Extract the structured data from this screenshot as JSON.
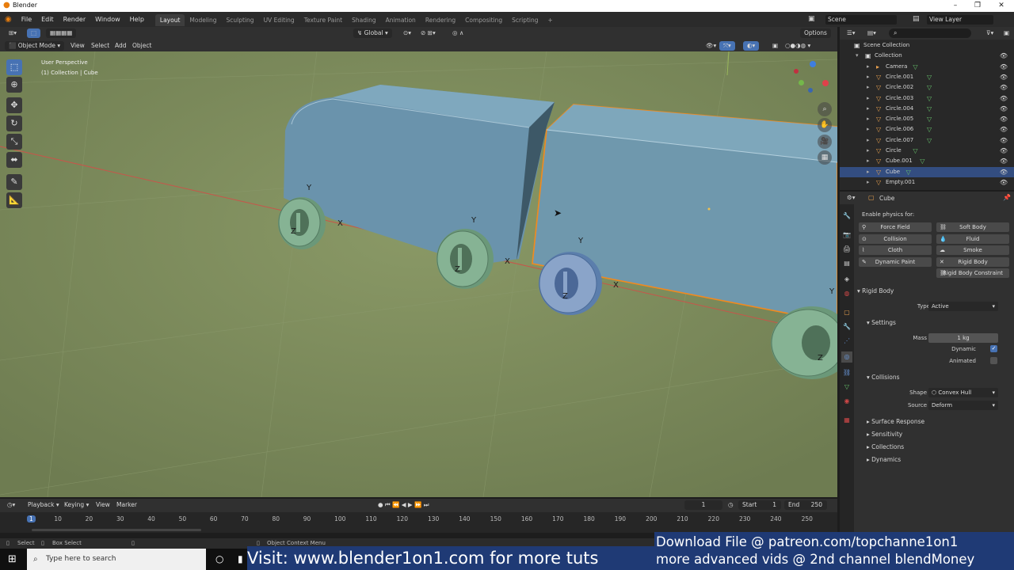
{
  "window": {
    "title": "Blender",
    "controls": [
      "–",
      "❐",
      "✕"
    ]
  },
  "menu": [
    "File",
    "Edit",
    "Render",
    "Window",
    "Help"
  ],
  "workspaces": [
    "Layout",
    "Modeling",
    "Sculpting",
    "UV Editing",
    "Texture Paint",
    "Shading",
    "Animation",
    "Rendering",
    "Compositing",
    "Scripting"
  ],
  "active_workspace": "Layout",
  "add_workspace": "+",
  "scene": {
    "label": "Scene",
    "view_layer": "View Layer"
  },
  "viewport": {
    "transform_orientation": "Global",
    "options_label": "Options",
    "mode": "Object Mode",
    "header_menus": [
      "View",
      "Select",
      "Add",
      "Object"
    ],
    "perspective": "User Perspective",
    "collection_info": "(1) Collection | Cube",
    "axis_labels": {
      "x": "X",
      "y": "Y",
      "z": "Z"
    }
  },
  "outliner": {
    "search_placeholder": "",
    "rows": [
      {
        "label": "Scene Collection",
        "indent": 0,
        "selected": false
      },
      {
        "label": "Collection",
        "indent": 1,
        "selected": false
      },
      {
        "label": "Camera",
        "indent": 2,
        "selected": false
      },
      {
        "label": "Circle.001",
        "indent": 2,
        "selected": false
      },
      {
        "label": "Circle.002",
        "indent": 2,
        "selected": false
      },
      {
        "label": "Circle.003",
        "indent": 2,
        "selected": false
      },
      {
        "label": "Circle.004",
        "indent": 2,
        "selected": false
      },
      {
        "label": "Circle.005",
        "indent": 2,
        "selected": false
      },
      {
        "label": "Circle.006",
        "indent": 2,
        "selected": false
      },
      {
        "label": "Circle.007",
        "indent": 2,
        "selected": false
      },
      {
        "label": "Circle",
        "indent": 2,
        "selected": false
      },
      {
        "label": "Cube.001",
        "indent": 2,
        "selected": false
      },
      {
        "label": "Cube",
        "indent": 2,
        "selected": true
      },
      {
        "label": "Empty.001",
        "indent": 2,
        "selected": false
      }
    ]
  },
  "properties": {
    "object_name": "Cube",
    "enable_physics_label": "Enable physics for:",
    "physics_buttons": [
      "Force Field",
      "Soft Body",
      "Collision",
      "Fluid",
      "Cloth",
      "Smoke",
      "Dynamic Paint",
      "Rigid Body",
      "Rigid Body Constraint"
    ],
    "rigid_body": {
      "title": "Rigid Body",
      "type_label": "Type",
      "type_value": "Active",
      "settings_title": "Settings",
      "mass_label": "Mass",
      "mass_value": "1 kg",
      "dynamic_label": "Dynamic",
      "dynamic_checked": true,
      "animated_label": "Animated",
      "animated_checked": false,
      "collisions_title": "Collisions",
      "shape_label": "Shape",
      "shape_value": "Convex Hull",
      "source_label": "Source",
      "source_value": "Deform",
      "collapsed": [
        "Surface Response",
        "Sensitivity",
        "Collections",
        "Dynamics"
      ]
    }
  },
  "timeline": {
    "menus": [
      "Playback",
      "Keying",
      "View",
      "Marker"
    ],
    "current_frame": "1",
    "start_label": "Start",
    "start_value": "1",
    "end_label": "End",
    "end_value": "250",
    "ticks": [
      "1",
      "10",
      "20",
      "30",
      "40",
      "50",
      "60",
      "70",
      "80",
      "90",
      "100",
      "110",
      "120",
      "130",
      "140",
      "150",
      "160",
      "170",
      "180",
      "190",
      "200",
      "210",
      "220",
      "230",
      "240",
      "250"
    ]
  },
  "statusbar": {
    "select": "Select",
    "box_select": "Box Select",
    "context_menu": "Object Context Menu"
  },
  "taskbar": {
    "search_placeholder": "Type here to search"
  },
  "banners": {
    "left": "Visit: www.blender1on1.com for more tuts",
    "right_line1": "Download File  @ patreon.com/topchanne1on1",
    "right_line2": "more advanced vids @ 2nd channel  blendMoney"
  },
  "colors": {
    "accent": "#4772b3",
    "selection_orange": "#f28a1e",
    "ground": "#7d8c5e",
    "object_blue": "#6f98ad",
    "wheel_green": "#7eae8a",
    "banner": "#1f3a75"
  }
}
